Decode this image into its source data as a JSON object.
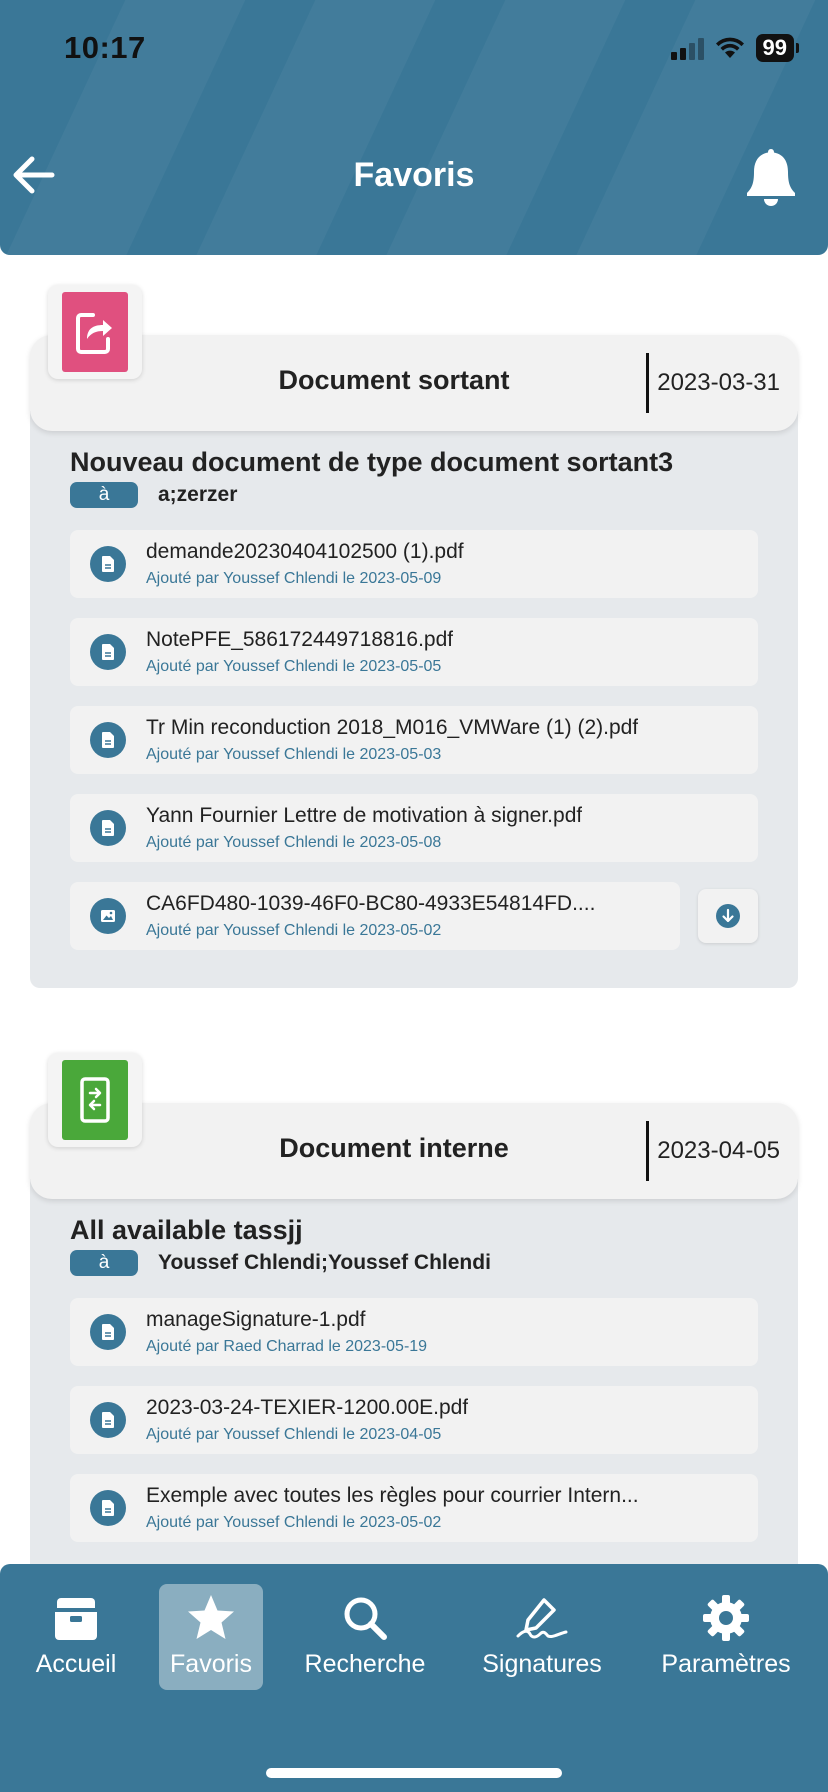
{
  "status_bar": {
    "time": "10:17",
    "battery": "99"
  },
  "header": {
    "title": "Favoris"
  },
  "cards": [
    {
      "type_label": "Document sortant",
      "date": "2023-03-31",
      "icon": "outgoing-document-icon",
      "icon_color": "#e0507f",
      "title": "Nouveau document de type document sortant3",
      "recipient_badge": "à",
      "recipient": "a;zerzer",
      "files": [
        {
          "name": "demande20230404102500 (1).pdf",
          "meta": "Ajouté par Youssef Chlendi le 2023-05-09",
          "icon": "file-icon"
        },
        {
          "name": "NotePFE_586172449718816.pdf",
          "meta": "Ajouté par Youssef Chlendi le 2023-05-05",
          "icon": "file-icon"
        },
        {
          "name": "Tr Min reconduction 2018_M016_VMWare (1) (2).pdf",
          "meta": "Ajouté par Youssef Chlendi le 2023-05-03",
          "icon": "file-icon"
        },
        {
          "name": "Yann Fournier Lettre de motivation à signer.pdf",
          "meta": "Ajouté par Youssef Chlendi le 2023-05-08",
          "icon": "file-icon"
        },
        {
          "name": "CA6FD480-1039-46F0-BC80-4933E54814FD....",
          "meta": "Ajouté par Youssef Chlendi le 2023-05-02",
          "icon": "image-icon"
        }
      ]
    },
    {
      "type_label": "Document interne",
      "date": "2023-04-05",
      "icon": "internal-document-icon",
      "icon_color": "#4aa83a",
      "title": "All available tassjj",
      "recipient_badge": "à",
      "recipient": "Youssef Chlendi;Youssef Chlendi",
      "files": [
        {
          "name": "manageSignature-1.pdf",
          "meta": "Ajouté par Raed Charrad le 2023-05-19",
          "icon": "file-icon"
        },
        {
          "name": "2023-03-24-TEXIER-1200.00E.pdf",
          "meta": "Ajouté par Youssef Chlendi le 2023-04-05",
          "icon": "file-icon"
        },
        {
          "name": "Exemple avec toutes les règles pour courrier Intern...",
          "meta": "Ajouté par Youssef Chlendi le 2023-05-02",
          "icon": "file-icon"
        }
      ]
    }
  ],
  "nav": {
    "items": [
      {
        "label": "Accueil",
        "icon": "inbox-icon"
      },
      {
        "label": "Favoris",
        "icon": "star-icon",
        "active": true
      },
      {
        "label": "Recherche",
        "icon": "search-icon"
      },
      {
        "label": "Signatures",
        "icon": "signature-icon"
      },
      {
        "label": "Paramètres",
        "icon": "gear-icon"
      }
    ]
  },
  "colors": {
    "primary": "#3a7797",
    "active_tab": "#8aaec0",
    "card_bg": "#e6e9ec"
  }
}
